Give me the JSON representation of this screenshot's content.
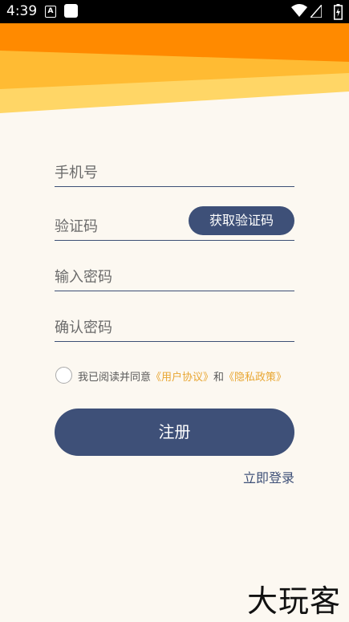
{
  "status_bar": {
    "time": "4:39",
    "icons": [
      "a-icon",
      "square-icon",
      "wifi-icon",
      "signal-icon",
      "battery-icon"
    ]
  },
  "colors": {
    "primary": "#3e5078",
    "accent": "#e8a632",
    "background": "#fcf8f1",
    "header_orange": "#ff8a00",
    "header_yellow": "#ffc94a"
  },
  "form": {
    "phone_placeholder": "手机号",
    "code_placeholder": "验证码",
    "get_code_label": "获取验证码",
    "password_placeholder": "输入密码",
    "confirm_placeholder": "确认密码"
  },
  "agreement": {
    "prefix": "我已阅读并同意",
    "terms": "《用户协议》",
    "and": "和",
    "privacy": "《隐私政策》"
  },
  "register_label": "注册",
  "login_link": "立即登录",
  "watermark": "大玩客"
}
